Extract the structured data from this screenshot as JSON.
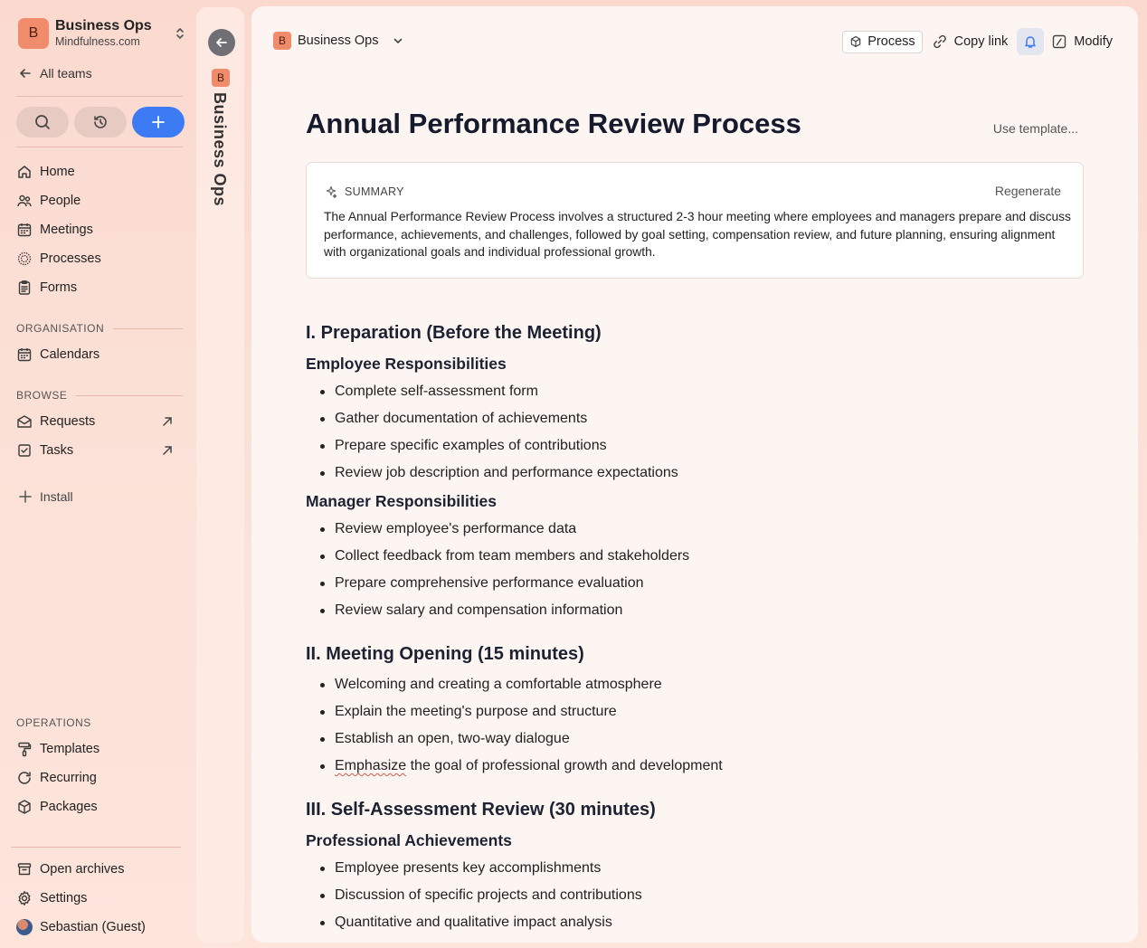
{
  "sidebar": {
    "team": {
      "initial": "B",
      "name": "Business Ops",
      "domain": "Mindfulness.com"
    },
    "all_teams": "All teams",
    "nav": [
      {
        "label": "Home",
        "icon": "home-icon"
      },
      {
        "label": "People",
        "icon": "people-icon"
      },
      {
        "label": "Meetings",
        "icon": "calendar-icon"
      },
      {
        "label": "Processes",
        "icon": "processes-icon"
      },
      {
        "label": "Forms",
        "icon": "clipboard-icon"
      }
    ],
    "organisation_label": "ORGANISATION",
    "organisation_items": [
      {
        "label": "Calendars",
        "icon": "calendar-icon"
      }
    ],
    "browse_label": "BROWSE",
    "browse_items": [
      {
        "label": "Requests",
        "icon": "inbox-icon"
      },
      {
        "label": "Tasks",
        "icon": "task-icon"
      }
    ],
    "install": "Install",
    "operations_label": "OPERATIONS",
    "operations_items": [
      {
        "label": "Templates",
        "icon": "template-icon"
      },
      {
        "label": "Recurring",
        "icon": "recurring-icon"
      },
      {
        "label": "Packages",
        "icon": "package-icon"
      }
    ],
    "footer_items": [
      {
        "label": "Open archives",
        "icon": "archive-icon"
      },
      {
        "label": "Settings",
        "icon": "gear-icon"
      },
      {
        "label": "Sebastian (Guest)",
        "icon": "avatar"
      }
    ]
  },
  "rail": {
    "initial": "B",
    "title": "Business Ops"
  },
  "header": {
    "crumb_initial": "B",
    "crumb_label": "Business Ops",
    "process_label": "Process",
    "copy_link_label": "Copy link",
    "modify_label": "Modify"
  },
  "doc": {
    "title": "Annual Performance Review Process",
    "use_template": "Use template...",
    "summary_label": "SUMMARY",
    "regenerate": "Regenerate",
    "summary_text": "The Annual Performance Review Process involves a structured 2-3 hour meeting where employees and managers prepare and discuss performance, achievements, and challenges, followed by goal setting, compensation review, and future planning, ensuring alignment with organizational goals and individual professional growth.",
    "sections": [
      {
        "heading": "I. Preparation (Before the Meeting)",
        "sub": [
          {
            "heading": "Employee Responsibilities",
            "items": [
              "Complete self-assessment form",
              "Gather documentation of achievements",
              "Prepare specific examples of contributions",
              "Review job description and performance expectations"
            ]
          },
          {
            "heading": "Manager Responsibilities",
            "items": [
              "Review employee's performance data",
              "Collect feedback from team members and stakeholders",
              "Prepare comprehensive performance evaluation",
              "Review salary and compensation information"
            ]
          }
        ]
      },
      {
        "heading": "II. Meeting Opening (15 minutes)",
        "items": [
          "Welcoming and creating a comfortable atmosphere",
          "Explain the meeting's purpose and structure",
          "Establish an open, two-way dialogue"
        ],
        "last_item_flagged": "Emphasize",
        "last_item_rest": " the goal of professional growth and development"
      },
      {
        "heading": "III. Self-Assessment Review (30 minutes)",
        "sub": [
          {
            "heading": "Professional Achievements",
            "items": [
              "Employee presents key accomplishments",
              "Discussion of specific projects and contributions",
              "Quantitative and qualitative impact analysis"
            ]
          }
        ]
      }
    ]
  }
}
